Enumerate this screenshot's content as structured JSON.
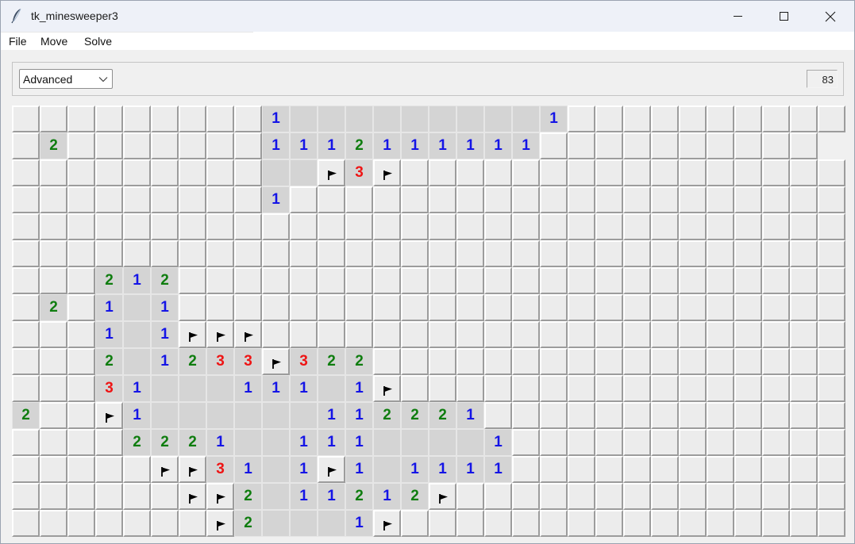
{
  "window": {
    "title": "tk_minesweeper3",
    "controls": [
      "minimize",
      "maximize",
      "close"
    ]
  },
  "menu": [
    "File",
    "Move",
    "Solve"
  ],
  "toolbar": {
    "difficulty": "Advanced",
    "counter": "83"
  },
  "board": {
    "rows": 16,
    "cols": 30,
    "legend": {
      "#": "unrevealed",
      ".": "revealed-empty",
      "F": "flag",
      "1-8": "revealed-number"
    },
    "number_colors": {
      "1": "#1414e6",
      "2": "#0f7d0f",
      "3": "#ee1515"
    },
    "grid": [
      "#########1.........1##########",
      "#2#######1112111111##########",
      "#########..F3F################",
      "#########1####################",
      "##############################",
      "##############################",
      "###212########################",
      "#2#1.1########################",
      "###1.1FFF#####################",
      "###2.1233F322#################",
      "###31...111.1F################",
      "2##F1......112221#############",
      "####2221..111....1############",
      "#####FF31.1F1.1111############",
      "######FF2.11212F##############",
      "#######F2...1F################"
    ]
  }
}
